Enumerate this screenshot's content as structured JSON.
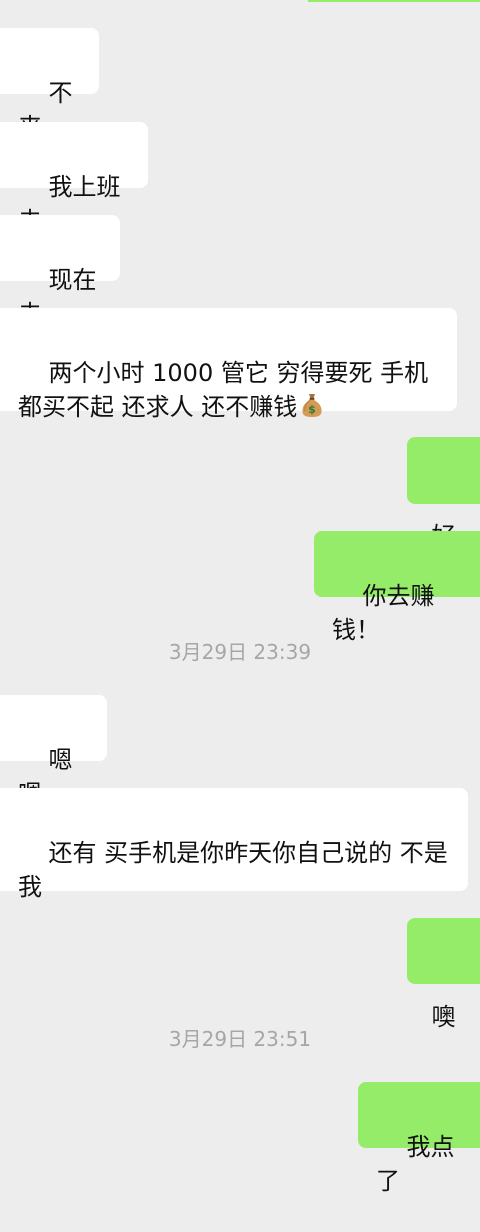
{
  "messages": [
    {
      "side": "in",
      "text": "不来"
    },
    {
      "side": "in",
      "text": "我上班去"
    },
    {
      "side": "in",
      "text": "现在去"
    },
    {
      "side": "in",
      "text": "两个小时 1000 管它 穷得要死 手机都买不起 还求人 还不赚钱",
      "emoji": "money-bag-icon"
    },
    {
      "side": "out",
      "text": "好"
    },
    {
      "side": "out",
      "text": "你去赚钱！"
    },
    {
      "type": "timestamp",
      "text": "3月29日 23:39"
    },
    {
      "side": "in",
      "text": "嗯嗯，"
    },
    {
      "side": "in",
      "text": "还有 买手机是你昨天你自己说的 不是我"
    },
    {
      "side": "out",
      "text": "噢"
    },
    {
      "type": "timestamp",
      "text": "3月29日 23:51"
    },
    {
      "side": "out",
      "text": "我点了"
    }
  ],
  "colors": {
    "background": "#ededed",
    "incoming_bubble": "#ffffff",
    "outgoing_bubble": "#95ec69",
    "timestamp_text": "#a6a6a6"
  }
}
